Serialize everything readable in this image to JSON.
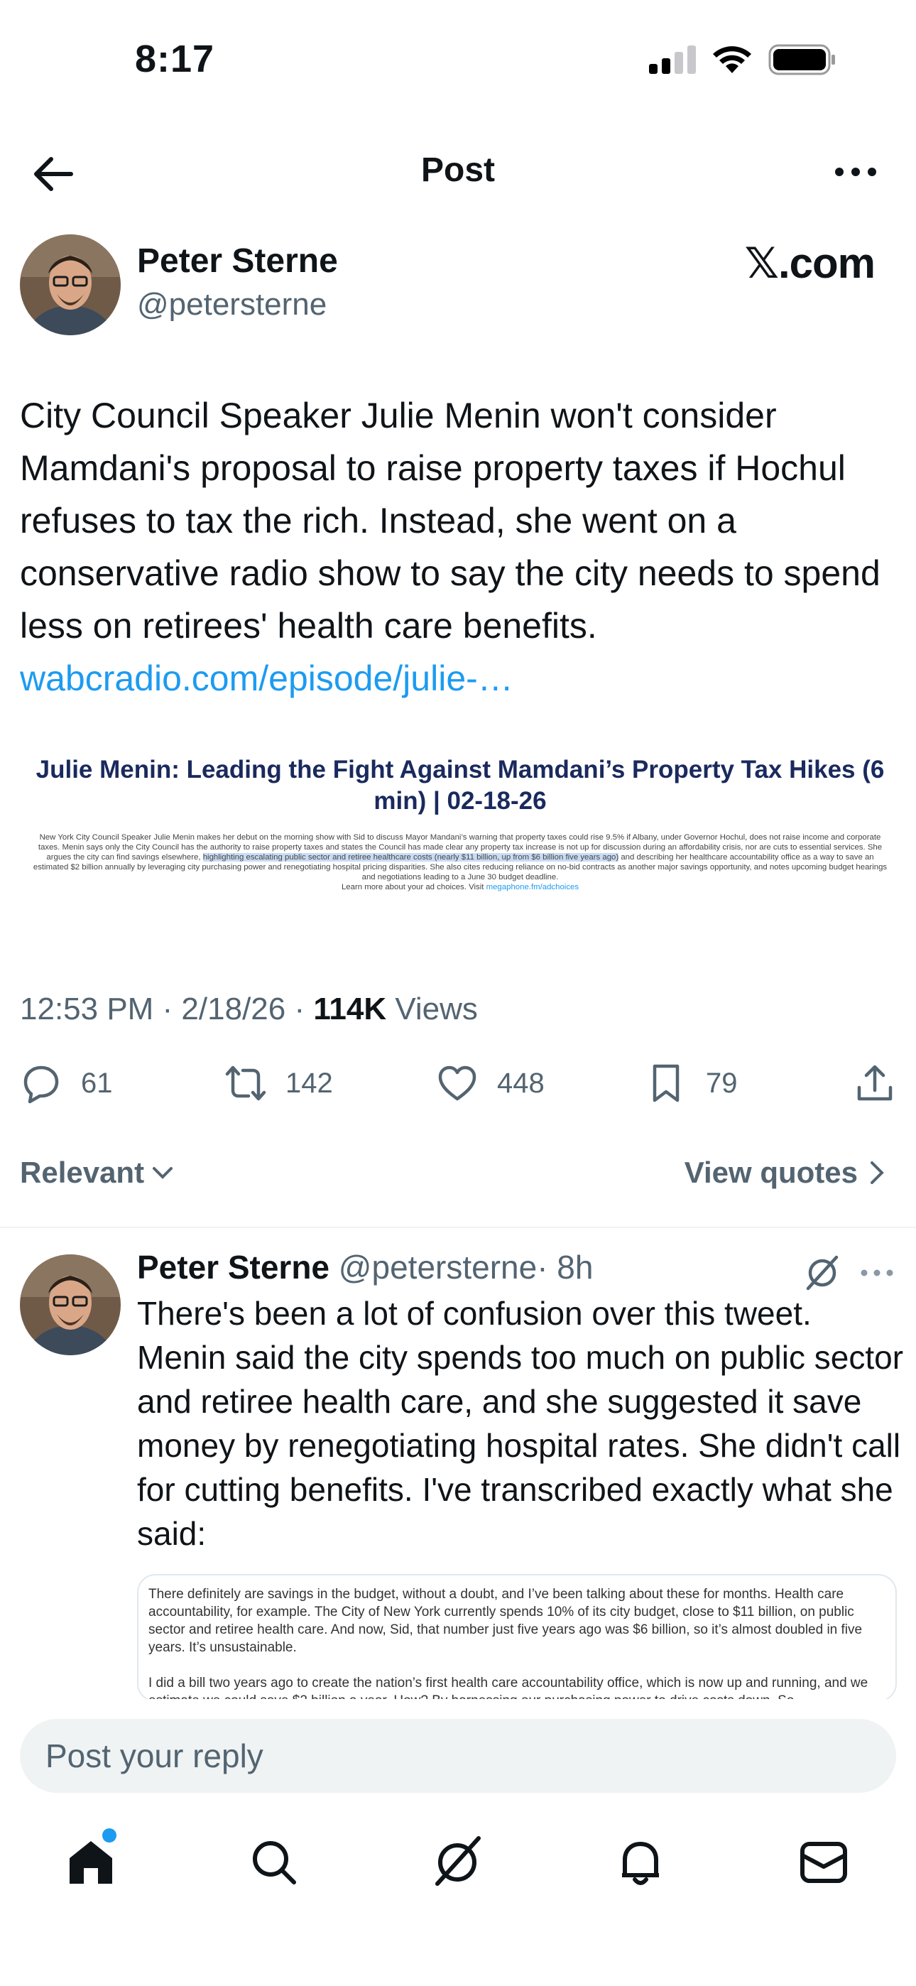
{
  "status_bar": {
    "time": "8:17"
  },
  "nav": {
    "title": "Post"
  },
  "post": {
    "author_name": "Peter Sterne",
    "author_handle": "@petersterne",
    "source_label": "𝕏.com",
    "text": "City Council Speaker Julie Menin won't consider Mamdani's proposal to raise property taxes if Hochul refuses to tax the rich. Instead, she went on a conservative radio show to say the city needs to spend less on retirees' health care benefits.",
    "link": "wabcradio.com/episode/julie-…",
    "embed": {
      "title": "Julie Menin: Leading the Fight Against Mamdani’s Property Tax Hikes (6 min) | 02-18-26",
      "body_before": "New York City Council Speaker Julie Menin makes her debut on the morning show with Sid to discuss Mayor Mandani’s warning that property taxes could rise 9.5% if Albany, under Governor Hochul, does not raise income and corporate taxes. Menin says only the City Council has the authority to raise property taxes and states the Council has made clear any property tax increase is not up for discussion during an affordability crisis, nor are cuts to essential services. She argues the city can find savings elsewhere, ",
      "body_highlight": "highlighting escalating public sector and retiree healthcare costs (nearly $11 billion, up from $6 billion five years ago)",
      "body_after": " and describing her healthcare accountability office as a way to save an estimated $2 billion annually by leveraging city purchasing power and renegotiating hospital pricing disparities. She also cites reducing reliance on no-bid contracts as another major savings opportunity, and notes upcoming budget hearings and negotiations leading to a June 30 budget deadline.",
      "footer_text": "Learn more about your ad choices. Visit ",
      "footer_link": "megaphone.fm/adchoices"
    },
    "time": "12:53 PM · 2/18/26 · ",
    "views_count": "114K",
    "views_label": " Views",
    "stats": {
      "replies": "61",
      "reposts": "142",
      "likes": "448",
      "bookmarks": "79"
    }
  },
  "sort": {
    "label": "Relevant",
    "view_quotes": "View quotes"
  },
  "reply": {
    "author_name": "Peter Sterne",
    "author_handle": "@petersterne",
    "age": "· 8h",
    "text": "There's been a lot of confusion over this tweet. Menin said the city spends too much on public sector and retiree health care, and she suggested it save money by renegotiating hospital rates. She didn't call for cutting benefits. I've transcribed exactly what she said:",
    "card_p1": "There definitely are savings in the budget, without a doubt, and I’ve been talking about these for months. Health care accountability, for example. The City of New York currently spends 10% of its city budget, close to $11 billion, on public sector and retiree health care. And now, Sid, that number just five years ago was $6 billion, so it’s almost doubled in five years. It’s unsustainable.",
    "card_p2": "I did a bill two years ago to create the nation’s first health care accountability office, which is now up and running, and we estimate we could save $2 billion a year. How? By harnessing our purchasing power to drive costs down. So"
  },
  "compose": {
    "placeholder": "Post your reply"
  },
  "colors": {
    "accent": "#1d9bf0",
    "text": "#0f1419",
    "secondary": "#536471"
  }
}
